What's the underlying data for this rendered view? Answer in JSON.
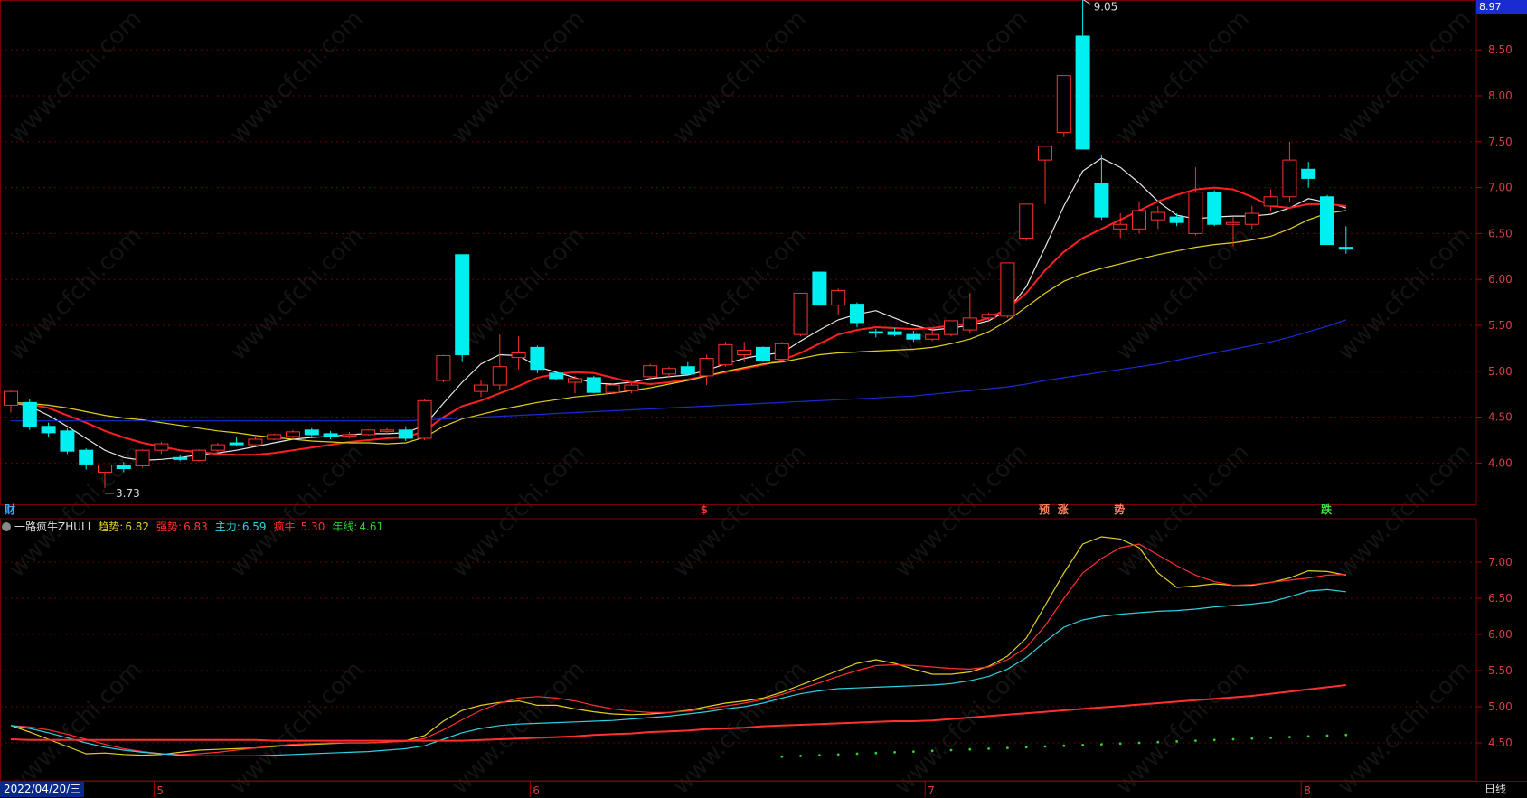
{
  "chart_data": {
    "type": "candlestick",
    "x_start": "2022/04/20/三",
    "period": "日线",
    "month_ticks": [
      "5",
      "6",
      "7",
      "8"
    ],
    "price_axis_ticks": [
      "8.50",
      "8.00",
      "7.50",
      "7.00",
      "6.50",
      "6.00",
      "5.50",
      "5.00",
      "4.50",
      "4.00"
    ],
    "price_top_label": "8.97",
    "high_marker": "9.05",
    "low_marker": "3.73",
    "ylim": [
      3.5,
      9.1
    ],
    "candles": [
      {
        "o": 4.63,
        "h": 4.8,
        "l": 4.55,
        "c": 4.78
      },
      {
        "o": 4.66,
        "h": 4.7,
        "l": 4.36,
        "c": 4.4
      },
      {
        "o": 4.4,
        "h": 4.44,
        "l": 4.28,
        "c": 4.33
      },
      {
        "o": 4.35,
        "h": 4.38,
        "l": 4.1,
        "c": 4.13
      },
      {
        "o": 4.14,
        "h": 4.16,
        "l": 3.93,
        "c": 3.99
      },
      {
        "o": 3.9,
        "h": 3.96,
        "l": 3.73,
        "c": 3.98
      },
      {
        "o": 3.97,
        "h": 4.01,
        "l": 3.9,
        "c": 3.94
      },
      {
        "o": 3.97,
        "h": 4.15,
        "l": 3.95,
        "c": 4.14
      },
      {
        "o": 4.14,
        "h": 4.23,
        "l": 4.1,
        "c": 4.21
      },
      {
        "o": 4.06,
        "h": 4.09,
        "l": 4.02,
        "c": 4.04
      },
      {
        "o": 4.03,
        "h": 4.15,
        "l": 4.02,
        "c": 4.14
      },
      {
        "o": 4.14,
        "h": 4.22,
        "l": 4.12,
        "c": 4.2
      },
      {
        "o": 4.22,
        "h": 4.28,
        "l": 4.18,
        "c": 4.2
      },
      {
        "o": 4.2,
        "h": 4.28,
        "l": 4.19,
        "c": 4.26
      },
      {
        "o": 4.26,
        "h": 4.32,
        "l": 4.25,
        "c": 4.31
      },
      {
        "o": 4.29,
        "h": 4.36,
        "l": 4.27,
        "c": 4.34
      },
      {
        "o": 4.36,
        "h": 4.38,
        "l": 4.29,
        "c": 4.31
      },
      {
        "o": 4.32,
        "h": 4.35,
        "l": 4.26,
        "c": 4.29
      },
      {
        "o": 4.3,
        "h": 4.34,
        "l": 4.27,
        "c": 4.31
      },
      {
        "o": 4.31,
        "h": 4.37,
        "l": 4.3,
        "c": 4.36
      },
      {
        "o": 4.35,
        "h": 4.38,
        "l": 4.31,
        "c": 4.36
      },
      {
        "o": 4.36,
        "h": 4.4,
        "l": 4.24,
        "c": 4.27
      },
      {
        "o": 4.27,
        "h": 4.7,
        "l": 4.25,
        "c": 4.68
      },
      {
        "o": 4.9,
        "h": 5.18,
        "l": 4.88,
        "c": 5.17
      },
      {
        "o": 6.27,
        "h": 6.27,
        "l": 5.1,
        "c": 5.18
      },
      {
        "o": 4.78,
        "h": 4.9,
        "l": 4.72,
        "c": 4.85
      },
      {
        "o": 4.85,
        "h": 5.4,
        "l": 4.8,
        "c": 5.05
      },
      {
        "o": 5.15,
        "h": 5.38,
        "l": 5.02,
        "c": 5.2
      },
      {
        "o": 5.26,
        "h": 5.28,
        "l": 4.98,
        "c": 5.02
      },
      {
        "o": 4.98,
        "h": 5.0,
        "l": 4.9,
        "c": 4.92
      },
      {
        "o": 4.88,
        "h": 4.95,
        "l": 4.76,
        "c": 4.92
      },
      {
        "o": 4.93,
        "h": 4.95,
        "l": 4.76,
        "c": 4.77
      },
      {
        "o": 4.77,
        "h": 4.87,
        "l": 4.75,
        "c": 4.85
      },
      {
        "o": 4.79,
        "h": 4.87,
        "l": 4.76,
        "c": 4.85
      },
      {
        "o": 4.94,
        "h": 5.08,
        "l": 4.9,
        "c": 5.06
      },
      {
        "o": 4.97,
        "h": 5.05,
        "l": 4.93,
        "c": 5.03
      },
      {
        "o": 5.05,
        "h": 5.1,
        "l": 4.95,
        "c": 4.97
      },
      {
        "o": 4.95,
        "h": 5.18,
        "l": 4.85,
        "c": 5.14
      },
      {
        "o": 5.07,
        "h": 5.32,
        "l": 5.05,
        "c": 5.29
      },
      {
        "o": 5.18,
        "h": 5.32,
        "l": 5.1,
        "c": 5.23
      },
      {
        "o": 5.26,
        "h": 5.27,
        "l": 5.1,
        "c": 5.12
      },
      {
        "o": 5.13,
        "h": 5.32,
        "l": 5.12,
        "c": 5.3
      },
      {
        "o": 5.4,
        "h": 5.85,
        "l": 5.38,
        "c": 5.85
      },
      {
        "o": 6.08,
        "h": 6.08,
        "l": 5.72,
        "c": 5.72
      },
      {
        "o": 5.72,
        "h": 5.9,
        "l": 5.62,
        "c": 5.88
      },
      {
        "o": 5.73,
        "h": 5.75,
        "l": 5.48,
        "c": 5.53
      },
      {
        "o": 5.43,
        "h": 5.46,
        "l": 5.37,
        "c": 5.42
      },
      {
        "o": 5.43,
        "h": 5.47,
        "l": 5.38,
        "c": 5.4
      },
      {
        "o": 5.4,
        "h": 5.44,
        "l": 5.32,
        "c": 5.35
      },
      {
        "o": 5.35,
        "h": 5.45,
        "l": 5.33,
        "c": 5.4
      },
      {
        "o": 5.4,
        "h": 5.55,
        "l": 5.38,
        "c": 5.55
      },
      {
        "o": 5.45,
        "h": 5.85,
        "l": 5.42,
        "c": 5.58
      },
      {
        "o": 5.58,
        "h": 5.64,
        "l": 5.55,
        "c": 5.62
      },
      {
        "o": 5.6,
        "h": 6.18,
        "l": 5.58,
        "c": 6.18
      },
      {
        "o": 6.45,
        "h": 6.82,
        "l": 6.42,
        "c": 6.82
      },
      {
        "o": 7.3,
        "h": 7.45,
        "l": 6.82,
        "c": 7.45
      },
      {
        "o": 7.6,
        "h": 8.22,
        "l": 7.55,
        "c": 8.22
      },
      {
        "o": 8.65,
        "h": 9.05,
        "l": 7.42,
        "c": 7.42
      },
      {
        "o": 7.05,
        "h": 7.35,
        "l": 6.65,
        "c": 6.68
      },
      {
        "o": 6.55,
        "h": 6.72,
        "l": 6.45,
        "c": 6.6
      },
      {
        "o": 6.55,
        "h": 6.85,
        "l": 6.5,
        "c": 6.75
      },
      {
        "o": 6.65,
        "h": 6.8,
        "l": 6.55,
        "c": 6.73
      },
      {
        "o": 6.68,
        "h": 6.72,
        "l": 6.58,
        "c": 6.62
      },
      {
        "o": 6.5,
        "h": 7.22,
        "l": 6.48,
        "c": 6.95
      },
      {
        "o": 6.95,
        "h": 6.97,
        "l": 6.58,
        "c": 6.6
      },
      {
        "o": 6.6,
        "h": 6.68,
        "l": 6.36,
        "c": 6.62
      },
      {
        "o": 6.6,
        "h": 6.8,
        "l": 6.55,
        "c": 6.72
      },
      {
        "o": 6.8,
        "h": 6.98,
        "l": 6.75,
        "c": 6.9
      },
      {
        "o": 6.9,
        "h": 7.5,
        "l": 6.85,
        "c": 7.3
      },
      {
        "o": 7.2,
        "h": 7.28,
        "l": 7.0,
        "c": 7.1
      },
      {
        "o": 6.9,
        "h": 6.92,
        "l": 6.38,
        "c": 6.38
      },
      {
        "o": 6.35,
        "h": 6.58,
        "l": 6.28,
        "c": 6.33
      }
    ],
    "price_lines": [
      {
        "name": "白线",
        "color": "#e8e8e8",
        "values": [
          4.66,
          4.62,
          4.52,
          4.4,
          4.27,
          4.14,
          4.06,
          4.03,
          4.04,
          4.06,
          4.09,
          4.11,
          4.14,
          4.18,
          4.22,
          4.26,
          4.28,
          4.29,
          4.31,
          4.32,
          4.32,
          4.33,
          4.41,
          4.65,
          4.88,
          5.08,
          5.18,
          5.17,
          5.05,
          4.99,
          4.93,
          4.87,
          4.86,
          4.88,
          4.92,
          4.94,
          4.96,
          5.01,
          5.08,
          5.14,
          5.18,
          5.2,
          5.33,
          5.45,
          5.56,
          5.62,
          5.66,
          5.58,
          5.5,
          5.45,
          5.47,
          5.5,
          5.55,
          5.66,
          5.92,
          6.35,
          6.8,
          7.18,
          7.32,
          7.22,
          7.05,
          6.85,
          6.7,
          6.66,
          6.68,
          6.69,
          6.69,
          6.71,
          6.78,
          6.88,
          6.84,
          6.78
        ]
      },
      {
        "name": "红线",
        "color": "#ff2020",
        "values": [
          4.66,
          4.64,
          4.6,
          4.52,
          4.44,
          4.35,
          4.28,
          4.22,
          4.18,
          4.14,
          4.12,
          4.1,
          4.09,
          4.09,
          4.11,
          4.14,
          4.17,
          4.2,
          4.23,
          4.25,
          4.27,
          4.28,
          4.35,
          4.5,
          4.62,
          4.68,
          4.76,
          4.84,
          4.93,
          4.97,
          4.99,
          4.98,
          4.93,
          4.88,
          4.86,
          4.88,
          4.91,
          4.95,
          4.99,
          5.03,
          5.07,
          5.12,
          5.2,
          5.3,
          5.4,
          5.45,
          5.48,
          5.47,
          5.46,
          5.47,
          5.5,
          5.52,
          5.58,
          5.68,
          5.85,
          6.1,
          6.3,
          6.45,
          6.55,
          6.65,
          6.75,
          6.85,
          6.92,
          6.98,
          7.0,
          6.98,
          6.9,
          6.8,
          6.78,
          6.82,
          6.82,
          6.8
        ]
      },
      {
        "name": "黄线",
        "color": "#e0d020",
        "values": [
          4.66,
          4.65,
          4.63,
          4.6,
          4.56,
          4.52,
          4.49,
          4.47,
          4.44,
          4.41,
          4.38,
          4.35,
          4.33,
          4.3,
          4.28,
          4.26,
          4.24,
          4.23,
          4.22,
          4.22,
          4.21,
          4.22,
          4.28,
          4.4,
          4.48,
          4.53,
          4.58,
          4.62,
          4.66,
          4.69,
          4.72,
          4.74,
          4.76,
          4.79,
          4.82,
          4.86,
          4.9,
          4.95,
          5.0,
          5.04,
          5.08,
          5.1,
          5.14,
          5.18,
          5.2,
          5.21,
          5.22,
          5.23,
          5.24,
          5.26,
          5.3,
          5.35,
          5.43,
          5.55,
          5.7,
          5.85,
          5.98,
          6.06,
          6.12,
          6.17,
          6.22,
          6.27,
          6.31,
          6.35,
          6.38,
          6.4,
          6.43,
          6.47,
          6.55,
          6.65,
          6.72,
          6.75
        ]
      },
      {
        "name": "蓝线",
        "color": "#1a2bd0",
        "values": [
          4.46,
          4.46,
          4.46,
          4.46,
          4.46,
          4.46,
          4.46,
          4.46,
          4.46,
          4.46,
          4.46,
          4.46,
          4.46,
          4.46,
          4.46,
          4.46,
          4.46,
          4.46,
          4.46,
          4.46,
          4.46,
          4.46,
          4.47,
          4.48,
          4.49,
          4.5,
          4.51,
          4.52,
          4.53,
          4.54,
          4.55,
          4.56,
          4.57,
          4.58,
          4.59,
          4.6,
          4.61,
          4.62,
          4.63,
          4.64,
          4.65,
          4.66,
          4.67,
          4.68,
          4.69,
          4.7,
          4.71,
          4.72,
          4.73,
          4.75,
          4.77,
          4.79,
          4.81,
          4.83,
          4.86,
          4.9,
          4.93,
          4.96,
          4.99,
          5.02,
          5.05,
          5.08,
          5.12,
          5.16,
          5.2,
          5.24,
          5.28,
          5.32,
          5.37,
          5.43,
          5.49,
          5.56
        ]
      }
    ],
    "signals": [
      {
        "index": 0,
        "text": "财",
        "color": "#3aaaff"
      },
      {
        "index": 37,
        "text": "$",
        "color": "#ff3030"
      },
      {
        "index": 55,
        "text": "预",
        "color": "#ff8060"
      },
      {
        "index": 56,
        "text": "涨",
        "color": "#ff8060"
      },
      {
        "index": 59,
        "text": "势",
        "color": "#ff8060"
      },
      {
        "index": 70,
        "text": "跌",
        "color": "#40e040"
      }
    ],
    "indicator": {
      "name": "一路疯牛ZHULI",
      "axis_ticks": [
        "7.00",
        "6.50",
        "6.00",
        "5.50",
        "5.00",
        "4.50"
      ],
      "ylim": [
        4.3,
        7.55
      ],
      "legend": [
        {
          "label": "趋势:",
          "value": "6.82",
          "color": "#e0d020"
        },
        {
          "label": "强势:",
          "value": "6.83",
          "color": "#ff3030"
        },
        {
          "label": "主力:",
          "value": "6.59",
          "color": "#30d0e0"
        },
        {
          "label": "疯牛:",
          "value": "5.30",
          "color": "#ff3030"
        },
        {
          "label": "年线:",
          "value": "4.61",
          "color": "#30d030"
        }
      ],
      "series": [
        {
          "name": "趋势",
          "color": "#e0d020",
          "values": [
            4.74,
            4.65,
            4.55,
            4.45,
            4.35,
            4.36,
            4.34,
            4.33,
            4.34,
            4.37,
            4.4,
            4.41,
            4.42,
            4.43,
            4.45,
            4.47,
            4.48,
            4.49,
            4.5,
            4.5,
            4.51,
            4.53,
            4.6,
            4.8,
            4.95,
            5.02,
            5.06,
            5.08,
            5.02,
            5.02,
            4.97,
            4.93,
            4.9,
            4.89,
            4.9,
            4.92,
            4.95,
            5.0,
            5.05,
            5.08,
            5.12,
            5.2,
            5.3,
            5.4,
            5.5,
            5.6,
            5.65,
            5.6,
            5.52,
            5.45,
            5.45,
            5.48,
            5.56,
            5.7,
            5.95,
            6.4,
            6.85,
            7.25,
            7.35,
            7.32,
            7.2,
            6.85,
            6.65,
            6.67,
            6.7,
            6.68,
            6.68,
            6.72,
            6.78,
            6.88,
            6.87,
            6.82
          ]
        },
        {
          "name": "强势",
          "color": "#ff3030",
          "values": [
            4.74,
            4.72,
            4.68,
            4.62,
            4.55,
            4.48,
            4.42,
            4.38,
            4.35,
            4.34,
            4.35,
            4.37,
            4.4,
            4.43,
            4.46,
            4.48,
            4.49,
            4.5,
            4.5,
            4.5,
            4.51,
            4.52,
            4.56,
            4.68,
            4.82,
            4.95,
            5.05,
            5.12,
            5.14,
            5.12,
            5.08,
            5.02,
            4.97,
            4.94,
            4.92,
            4.92,
            4.94,
            4.97,
            5.01,
            5.05,
            5.1,
            5.17,
            5.25,
            5.33,
            5.42,
            5.5,
            5.57,
            5.58,
            5.57,
            5.55,
            5.53,
            5.52,
            5.55,
            5.65,
            5.82,
            6.12,
            6.5,
            6.85,
            7.05,
            7.2,
            7.25,
            7.1,
            6.95,
            6.82,
            6.73,
            6.68,
            6.69,
            6.72,
            6.75,
            6.78,
            6.82,
            6.83
          ]
        },
        {
          "name": "主力",
          "color": "#30d0e0",
          "values": [
            4.74,
            4.7,
            4.64,
            4.57,
            4.5,
            4.44,
            4.4,
            4.37,
            4.35,
            4.33,
            4.32,
            4.32,
            4.32,
            4.32,
            4.33,
            4.34,
            4.35,
            4.36,
            4.37,
            4.38,
            4.4,
            4.42,
            4.46,
            4.55,
            4.64,
            4.7,
            4.74,
            4.76,
            4.77,
            4.78,
            4.79,
            4.8,
            4.81,
            4.83,
            4.85,
            4.87,
            4.9,
            4.93,
            4.97,
            5.0,
            5.05,
            5.12,
            5.18,
            5.22,
            5.25,
            5.26,
            5.27,
            5.28,
            5.29,
            5.3,
            5.32,
            5.36,
            5.42,
            5.52,
            5.68,
            5.9,
            6.1,
            6.2,
            6.25,
            6.28,
            6.3,
            6.32,
            6.33,
            6.35,
            6.38,
            6.4,
            6.42,
            6.45,
            6.52,
            6.6,
            6.62,
            6.59
          ]
        },
        {
          "name": "疯牛",
          "color": "#ff3030",
          "values": [
            4.55,
            4.54,
            4.54,
            4.54,
            4.54,
            4.54,
            4.54,
            4.54,
            4.54,
            4.54,
            4.54,
            4.54,
            4.54,
            4.54,
            4.53,
            4.53,
            4.53,
            4.53,
            4.53,
            4.53,
            4.53,
            4.53,
            4.53,
            4.53,
            4.53,
            4.54,
            4.55,
            4.56,
            4.57,
            4.58,
            4.59,
            4.61,
            4.62,
            4.63,
            4.65,
            4.66,
            4.67,
            4.69,
            4.7,
            4.71,
            4.73,
            4.74,
            4.75,
            4.76,
            4.77,
            4.78,
            4.79,
            4.8,
            4.8,
            4.81,
            4.83,
            4.85,
            4.87,
            4.89,
            4.91,
            4.93,
            4.95,
            4.97,
            4.99,
            5.01,
            5.03,
            5.05,
            5.07,
            5.09,
            5.11,
            5.13,
            5.15,
            5.18,
            5.21,
            5.24,
            5.27,
            5.3
          ]
        }
      ],
      "year_line": {
        "name": "年线",
        "color": "#30d030",
        "start_index": 41,
        "values": [
          4.31,
          4.32,
          4.33,
          4.34,
          4.35,
          4.36,
          4.37,
          4.38,
          4.39,
          4.4,
          4.41,
          4.42,
          4.43,
          4.44,
          4.45,
          4.46,
          4.47,
          4.48,
          4.49,
          4.5,
          4.51,
          4.52,
          4.53,
          4.54,
          4.55,
          4.56,
          4.57,
          4.58,
          4.59,
          4.6,
          4.61
        ]
      }
    }
  }
}
